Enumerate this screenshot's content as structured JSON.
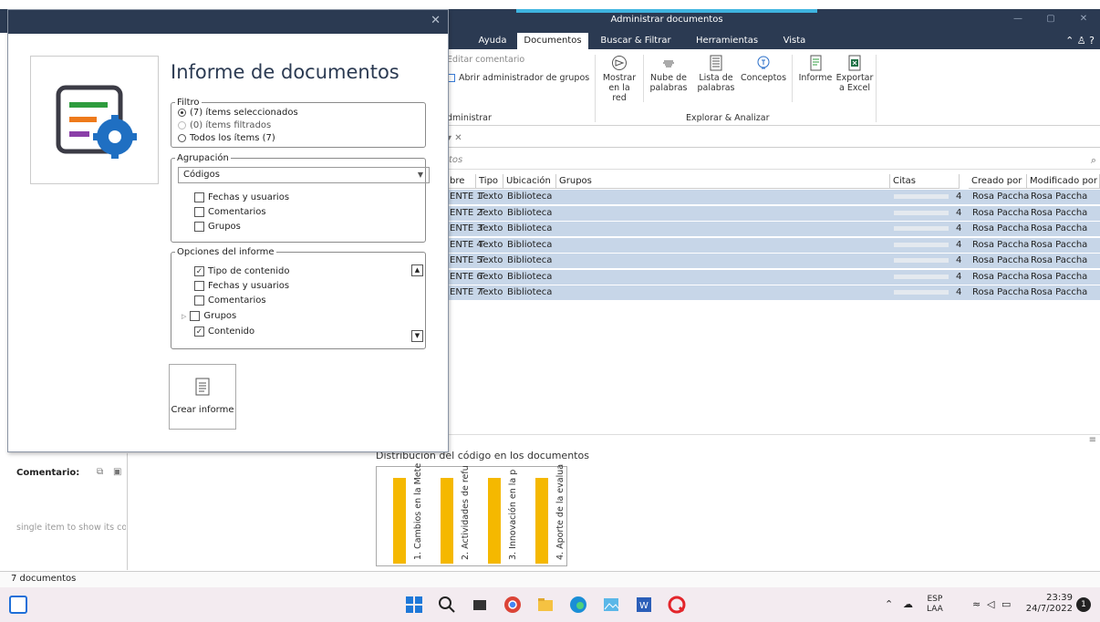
{
  "window": {
    "context_title": "Administrar documentos",
    "controls": [
      "—",
      "▢",
      "✕"
    ]
  },
  "ribbon_tabs": [
    "Ayuda",
    "Documentos",
    "Buscar & Filtrar",
    "Herramientas",
    "Vista"
  ],
  "ribbon": {
    "edit_comment": "Editar comentario",
    "open_group_admin": "Abrir administrador de grupos",
    "group_admin": "dministrar",
    "show_network": [
      "Mostrar",
      "en la red"
    ],
    "word_cloud": [
      "Nube de",
      "palabras"
    ],
    "word_list": [
      "Lista de",
      "palabras"
    ],
    "concepts": "Conceptos",
    "report": "Informe",
    "export_excel": [
      "Exportar",
      "a Excel"
    ],
    "group_explore": "Explorar & Analizar"
  },
  "doc_tab": "▾ ✕",
  "search": {
    "placeholder": "tos"
  },
  "table": {
    "headers": [
      "bre",
      "Tipo",
      "Ubicación",
      "Grupos",
      "Citas",
      "Creado por",
      "Modificado por"
    ],
    "rows": [
      {
        "name": "ENTE 1",
        "type": "Texto",
        "location": "Biblioteca",
        "citas": "4",
        "created": "Rosa Paccha",
        "modified": "Rosa Paccha"
      },
      {
        "name": "ENTE 2",
        "type": "Texto",
        "location": "Biblioteca",
        "citas": "4",
        "created": "Rosa Paccha",
        "modified": "Rosa Paccha"
      },
      {
        "name": "ENTE 3",
        "type": "Texto",
        "location": "Biblioteca",
        "citas": "4",
        "created": "Rosa Paccha",
        "modified": "Rosa Paccha"
      },
      {
        "name": "ENTE 4",
        "type": "Texto",
        "location": "Biblioteca",
        "citas": "4",
        "created": "Rosa Paccha",
        "modified": "Rosa Paccha"
      },
      {
        "name": "ENTE 5",
        "type": "Texto",
        "location": "Biblioteca",
        "citas": "4",
        "created": "Rosa Paccha",
        "modified": "Rosa Paccha"
      },
      {
        "name": "ENTE 6",
        "type": "Texto",
        "location": "Biblioteca",
        "citas": "4",
        "created": "Rosa Paccha",
        "modified": "Rosa Paccha"
      },
      {
        "name": "ENTE 7",
        "type": "Texto",
        "location": "Biblioteca",
        "citas": "4",
        "created": "Rosa Paccha",
        "modified": "Rosa Paccha"
      }
    ]
  },
  "side_panel": {
    "comment_label": "Comentario:",
    "hint": "single item to show its co"
  },
  "chart": {
    "title": "Distribución del código en los documentos",
    "bars": [
      {
        "label": "1. Cambios en la Mete",
        "value": "7"
      },
      {
        "label": "2. Actividades de refu",
        "value": "7"
      },
      {
        "label": "3. Innovación en la p",
        "value": "7"
      },
      {
        "label": "4. Aporte de la evalua",
        "value": "7"
      }
    ]
  },
  "status": "7 documentos",
  "taskbar": {
    "lang": [
      "ESP",
      "LAA"
    ],
    "time": "23:39",
    "date": "24/7/2022",
    "notif": "1"
  },
  "dialog": {
    "close": "✕",
    "title": "Informe de documentos",
    "filter_legend": "Filtro",
    "filter_options": [
      "(7) ítems seleccionados",
      "(0) ítems filtrados",
      "Todos los ítems (7)"
    ],
    "grouping_legend": "Agrupación",
    "grouping_value": "Códigos",
    "grouping_checks": [
      "Fechas y usuarios",
      "Comentarios",
      "Grupos"
    ],
    "options_legend": "Opciones del informe",
    "options": [
      {
        "label": "Tipo de contenido",
        "checked": true
      },
      {
        "label": "Fechas y usuarios",
        "checked": false
      },
      {
        "label": "Comentarios",
        "checked": false
      },
      {
        "label": "Grupos",
        "checked": false
      },
      {
        "label": "Contenido",
        "checked": true
      }
    ],
    "create_button": "Crear informe"
  },
  "colors": {
    "titlebar": "#2b3a52",
    "accent": "#3fb4e0",
    "selected_row": "#c7d6e8",
    "chart_bar": "#f5b800",
    "icon_green": "#2e9c3e",
    "icon_orange": "#ee7a1b",
    "icon_purple": "#8b3fa8",
    "icon_gear": "#1f6fc2"
  }
}
